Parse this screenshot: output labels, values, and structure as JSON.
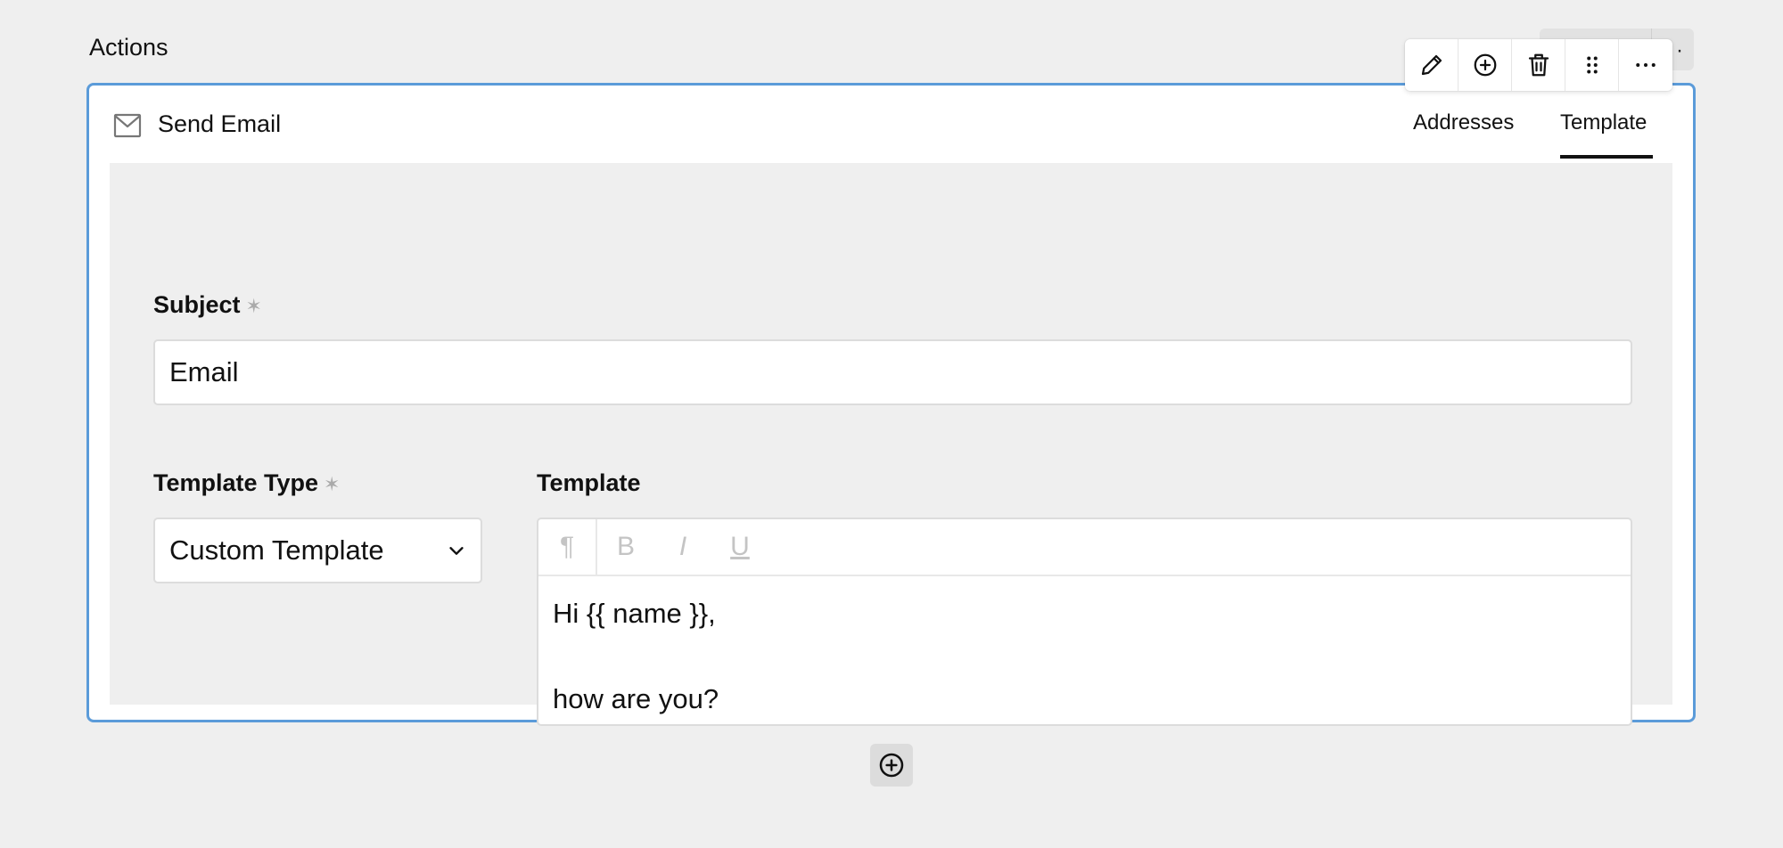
{
  "section": {
    "title": "Actions"
  },
  "toolbar": {
    "items": [
      {
        "icon": "pencil-icon",
        "label": "Edit"
      },
      {
        "icon": "plus-circle-icon",
        "label": "Add"
      },
      {
        "icon": "trash-icon",
        "label": "Delete"
      },
      {
        "icon": "drag-handle-icon",
        "label": "Drag"
      },
      {
        "icon": "more-horizontal-icon",
        "label": "More"
      }
    ]
  },
  "card": {
    "icon": "mail-icon",
    "title": "Send Email",
    "tabs": [
      {
        "label": "Addresses",
        "active": false
      },
      {
        "label": "Template",
        "active": true
      }
    ],
    "accent_color": "#5b9bd9"
  },
  "form": {
    "subject": {
      "label": "Subject",
      "required_mark": "✶",
      "value": "Email"
    },
    "template_type": {
      "label": "Template Type",
      "required_mark": "✶",
      "value": "Custom Template"
    },
    "template": {
      "label": "Template",
      "toolbar": [
        "¶",
        "B",
        "I",
        "U"
      ],
      "lines": [
        "Hi {{ name }},",
        "",
        "how are you?"
      ]
    }
  },
  "add_button": {
    "icon": "plus-circle-icon"
  }
}
